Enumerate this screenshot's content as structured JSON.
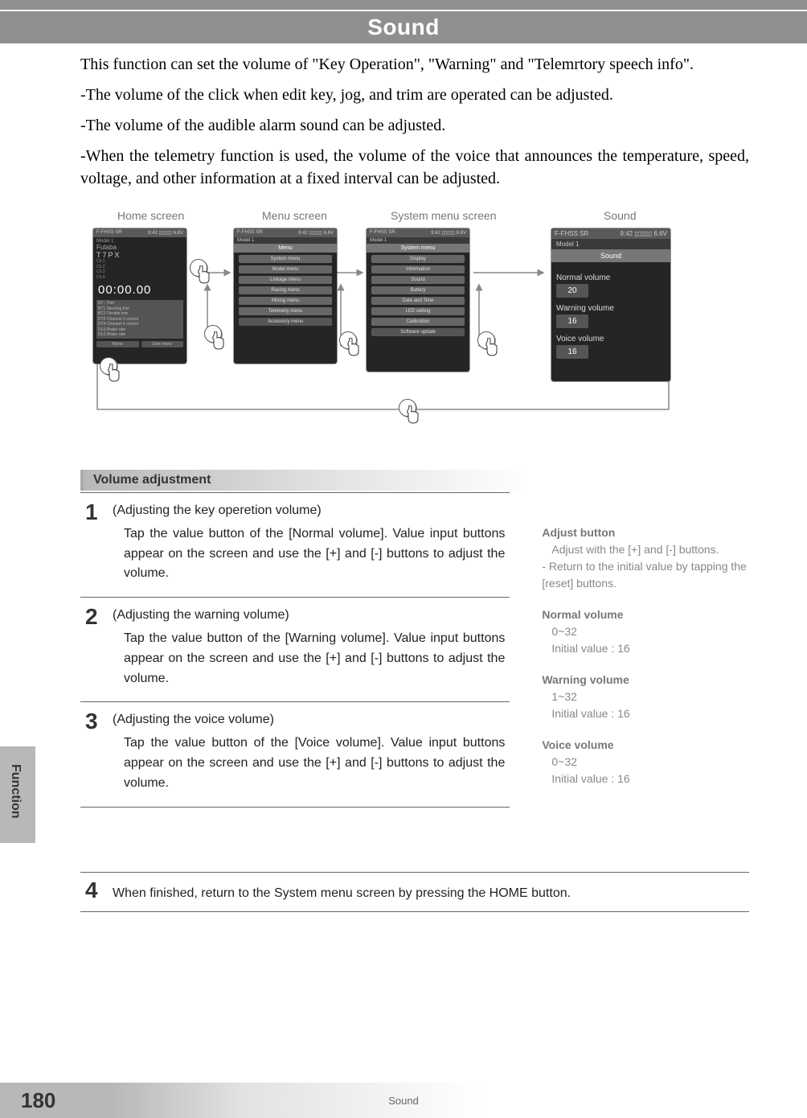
{
  "title": "Sound",
  "intro": {
    "p1": "This function can set the volume of \"Key Operation\", \"Warning\" and \"Telemrtory speech info\".",
    "p2": "-The volume of the click when edit key, jog, and trim are operated can be adjusted.",
    "p3": "-The volume of the audible alarm sound can be adjusted.",
    "p4": "-When the telemetry function is used, the volume of the voice that announces the temperature, speed, voltage, and other information at a fixed interval can be adjusted."
  },
  "nav": {
    "labels": [
      "Home screen",
      "Menu screen",
      "System menu screen",
      "Sound"
    ],
    "home": {
      "header_left": "F-FHSS SR",
      "header_right": "9:42  ▯▯▯▯▯ 6.6V",
      "model": "Model 1",
      "brand": "Futaba",
      "line": "T7PX",
      "chs": [
        "Ch.1",
        "Ch.2",
        "Ch.3",
        "Ch.4"
      ],
      "timer": "00:00.00",
      "sublines": [
        "ST : Trim",
        "BT1 Steering trim",
        "BT2 Throttle trim",
        "DT3 Channel 3 control",
        "DT4 Channel 4 control",
        "DLS Brake rate",
        "DLS Brake rate"
      ],
      "footer": [
        "Home",
        "User menu"
      ]
    },
    "menu": {
      "title": "Menu",
      "items": [
        "System menu",
        "Model menu",
        "Linkage menu",
        "Racing menu",
        "Mixing menu",
        "Telemetry menu",
        "Accessory menu"
      ]
    },
    "system": {
      "title": "System menu",
      "items": [
        "Display",
        "Information",
        "Sound",
        "Battery",
        "Date and Time",
        "LED setting",
        "Calibration",
        "Software update"
      ]
    },
    "sound": {
      "title": "Sound",
      "normal_label": "Normal volume",
      "normal_val": "20",
      "warning_label": "Warning volume",
      "warning_val": "16",
      "voice_label": "Voice volume",
      "voice_val": "16"
    }
  },
  "section_heading": "Volume adjustment",
  "steps": [
    {
      "num": "1",
      "title": "(Adjusting the key operetion volume)",
      "text": "Tap the value button of the [Normal volume]. Value input buttons appear on the screen and use the [+] and [-] buttons to adjust the volume."
    },
    {
      "num": "2",
      "title": "(Adjusting the warning volume)",
      "text": "Tap the value button of the [Warning volume]. Value input buttons appear on the screen and use the [+] and [-] buttons to adjust the volume."
    },
    {
      "num": "3",
      "title": "(Adjusting the voice volume)",
      "text": "Tap the value button of the [Voice volume]. Value input buttons appear on the screen and use the [+] and [-] buttons to adjust the volume."
    }
  ],
  "notes": {
    "adjust": {
      "title": "Adjust button",
      "l1": "Adjust with the [+] and [-] buttons.",
      "l2": "- Return to the initial value by tapping the [reset] buttons."
    },
    "normal": {
      "title": "Normal volume",
      "l1": "0~32",
      "l2": "Initial value : 16"
    },
    "warning": {
      "title": "Warning volume",
      "l1": "1~32",
      "l2": "Initial value : 16"
    },
    "voice": {
      "title": "Voice volume",
      "l1": "0~32",
      "l2": "Initial value : 16"
    }
  },
  "step4": {
    "num": "4",
    "text": "When finished, return to the System menu screen by pressing the HOME button."
  },
  "sidebar": "Function",
  "footer_label": "Sound",
  "page_num": "180"
}
